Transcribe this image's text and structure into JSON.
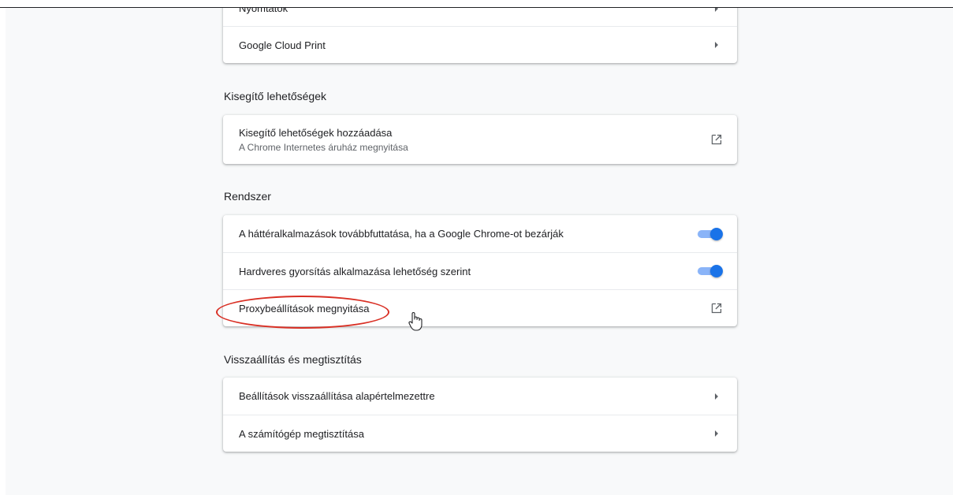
{
  "sections": {
    "printing": {
      "rows": [
        {
          "label": "Nyomtatók"
        },
        {
          "label": "Google Cloud Print"
        }
      ]
    },
    "accessibility": {
      "title": "Kisegítő lehetőségek",
      "add": {
        "label": "Kisegítő lehetőségek hozzáadása",
        "sublabel": "A Chrome Internetes áruház megnyitása"
      }
    },
    "system": {
      "title": "Rendszer",
      "background_apps": {
        "label": "A háttéralkalmazások továbbfuttatása, ha a Google Chrome-ot bezárják",
        "enabled": true
      },
      "hardware_accel": {
        "label": "Hardveres gyorsítás alkalmazása lehetőség szerint",
        "enabled": true
      },
      "proxy": {
        "label": "Proxybeállítások megnyitása"
      }
    },
    "reset": {
      "title": "Visszaállítás és megtisztítás",
      "rows": [
        {
          "label": "Beállítások visszaállítása alapértelmezettre"
        },
        {
          "label": "A számítógép megtisztítása"
        }
      ]
    }
  },
  "colors": {
    "accent": "#1a73e8",
    "highlight": "#d93025"
  }
}
